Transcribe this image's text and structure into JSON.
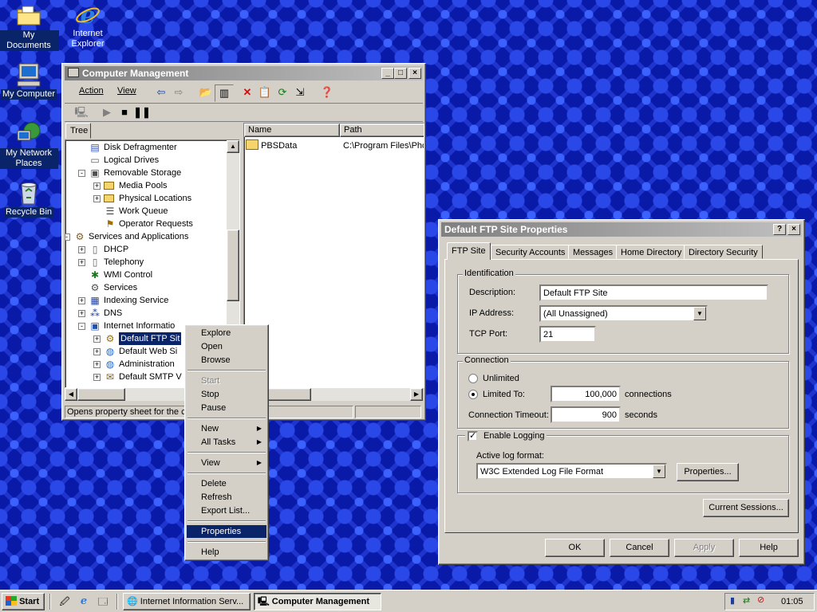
{
  "desktop": {
    "icons": [
      {
        "label": "My Documents",
        "icon": "folder-documents-icon"
      },
      {
        "label": "Internet Explorer",
        "icon": "internet-explorer-icon"
      },
      {
        "label": "My Computer",
        "icon": "computer-icon"
      },
      {
        "label": "My Network Places",
        "icon": "network-icon"
      },
      {
        "label": "Recycle Bin",
        "icon": "recycle-bin-icon"
      }
    ]
  },
  "cm": {
    "title": "Computer Management",
    "menu": {
      "action": "Action",
      "view": "View"
    },
    "tree_tab": "Tree",
    "tree": [
      {
        "label": "Disk Defragmenter",
        "icon": "defrag-icon"
      },
      {
        "label": "Logical Drives",
        "icon": "drive-icon"
      },
      {
        "label": "Removable Storage",
        "icon": "removable-storage-icon"
      },
      {
        "label": "Media Pools",
        "icon": "folder-icon"
      },
      {
        "label": "Physical Locations",
        "icon": "folder-icon"
      },
      {
        "label": "Work Queue",
        "icon": "queue-icon"
      },
      {
        "label": "Operator Requests",
        "icon": "request-icon"
      },
      {
        "label": "Services and Applications",
        "icon": "services-apps-icon"
      },
      {
        "label": "DHCP",
        "icon": "server-icon"
      },
      {
        "label": "Telephony",
        "icon": "server-icon"
      },
      {
        "label": "WMI Control",
        "icon": "wmi-icon"
      },
      {
        "label": "Services",
        "icon": "gear-icon"
      },
      {
        "label": "Indexing Service",
        "icon": "index-icon"
      },
      {
        "label": "DNS",
        "icon": "dns-icon"
      },
      {
        "label": "Internet Informatio",
        "icon": "iis-icon"
      },
      {
        "label": "Default FTP Sit",
        "icon": "ftp-icon"
      },
      {
        "label": "Default Web Si",
        "icon": "web-icon"
      },
      {
        "label": "Administration",
        "icon": "web-icon"
      },
      {
        "label": "Default SMTP V",
        "icon": "smtp-icon"
      }
    ],
    "list_headers": {
      "name": "Name",
      "path": "Path"
    },
    "list_rows": [
      {
        "name": "PBSData",
        "path": "C:\\Program Files\\Pho"
      }
    ],
    "status": "Opens property sheet for the c"
  },
  "context_menu": {
    "explore": "Explore",
    "open": "Open",
    "browse": "Browse",
    "start": "Start",
    "stop": "Stop",
    "pause": "Pause",
    "new": "New",
    "all_tasks": "All Tasks",
    "view": "View",
    "delete": "Delete",
    "refresh": "Refresh",
    "export": "Export List...",
    "properties": "Properties",
    "help": "Help"
  },
  "dialog": {
    "title": "Default FTP Site Properties",
    "tabs": [
      "FTP Site",
      "Security Accounts",
      "Messages",
      "Home Directory",
      "Directory Security"
    ],
    "identification": {
      "group": "Identification",
      "description_label": "Description:",
      "description": "Default FTP Site",
      "ip_label": "IP Address:",
      "ip": "(All Unassigned)",
      "port_label": "TCP Port:",
      "port": "21"
    },
    "connection": {
      "group": "Connection",
      "unlimited": "Unlimited",
      "limited": "Limited To:",
      "limit": "100,000",
      "connections": "connections",
      "timeout_label": "Connection Timeout:",
      "timeout": "900",
      "seconds": "seconds"
    },
    "logging": {
      "enable": "Enable Logging",
      "format_label": "Active log format:",
      "format": "W3C Extended Log File Format",
      "properties": "Properties..."
    },
    "current_sessions": "Current Sessions...",
    "buttons": {
      "ok": "OK",
      "cancel": "Cancel",
      "apply": "Apply",
      "help": "Help"
    }
  },
  "taskbar": {
    "start": "Start",
    "tasks": [
      "Internet Information Serv...",
      "Computer Management"
    ],
    "clock": "01:05"
  }
}
